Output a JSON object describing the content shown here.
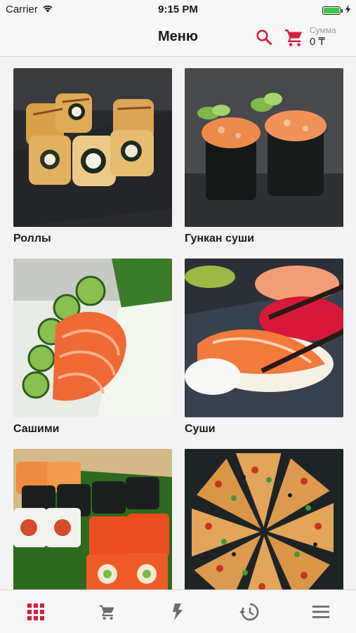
{
  "status_bar": {
    "carrier": "Carrier",
    "time": "9:15 PM",
    "battery_level": 1.0
  },
  "nav": {
    "title": "Меню",
    "sum_label": "Сумма",
    "sum_value": "0 ₸"
  },
  "categories": [
    {
      "label": "Роллы"
    },
    {
      "label": "Гункан суши"
    },
    {
      "label": "Сашими"
    },
    {
      "label": "Суши"
    },
    {
      "label": ""
    },
    {
      "label": ""
    }
  ],
  "tab_bar": {
    "items": [
      {
        "icon": "grid-icon",
        "active": true
      },
      {
        "icon": "cart-icon",
        "active": false
      },
      {
        "icon": "lightning-icon",
        "active": false
      },
      {
        "icon": "history-icon",
        "active": false
      },
      {
        "icon": "menu-icon",
        "active": false
      }
    ]
  },
  "colors": {
    "accent": "#d11f3c",
    "tab_inactive": "#6d6d6d",
    "battery": "#39c64a"
  }
}
